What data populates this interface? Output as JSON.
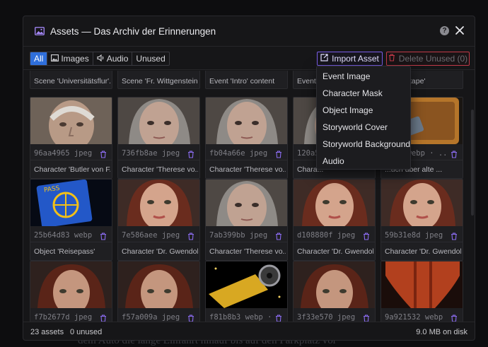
{
  "background_text": "dem Auto die lange Einfahrt hinauf bis auf den Parkplatz vor",
  "modal": {
    "title": "Assets — Das Archiv der Erinnerungen",
    "help_glyph": "?"
  },
  "tabs": [
    {
      "label": "All",
      "active": true,
      "icon": ""
    },
    {
      "label": "Images",
      "active": false,
      "icon": "image-icon"
    },
    {
      "label": "Audio",
      "active": false,
      "icon": "speaker-icon"
    },
    {
      "label": "Unused",
      "active": false,
      "icon": ""
    }
  ],
  "import_label": "Import Asset",
  "delete_label": "Delete Unused (0)",
  "grid": {
    "partial_captions": [
      "Scene 'Universitätsflur'...",
      "Scene 'Fr. Wittgenstein...",
      "Event 'Intro' content",
      "Event '...",
      "...anzertape'"
    ],
    "rows": [
      [
        {
          "meta": "96aa4965 jpeg · ...",
          "caption": "Character 'Butler von F...",
          "thumb": "old-man"
        },
        {
          "meta": "736fb8ae jpeg · ...",
          "caption": "Character 'Therese vo...",
          "thumb": "old-woman"
        },
        {
          "meta": "fb04a66e jpeg · ...",
          "caption": "Character 'Therese vo...",
          "thumb": "old-woman"
        },
        {
          "meta": "120a5...",
          "caption": "Chara...",
          "thumb": "old-woman"
        },
        {
          "meta": "...5 webp · ...",
          "caption": "...uch über alte ...",
          "thumb": "book"
        }
      ],
      [
        {
          "meta": "25b64d83 webp · ...",
          "caption": "Object 'Reisepass'",
          "thumb": "passport"
        },
        {
          "meta": "7e586aee jpeg · ...",
          "caption": "Character 'Dr. Gwendol...",
          "thumb": "red-hair"
        },
        {
          "meta": "7ab399bb jpeg · ...",
          "caption": "Character 'Therese vo...",
          "thumb": "old-woman"
        },
        {
          "meta": "d108880f jpeg · ...",
          "caption": "Character 'Dr. Gwendol...",
          "thumb": "red-hair"
        },
        {
          "meta": "59b31e8d jpeg · ...",
          "caption": "Character 'Dr. Gwendol...",
          "thumb": "red-hair"
        }
      ],
      [
        {
          "meta": "f7b2677d jpeg · ...",
          "caption": "",
          "thumb": "red-hair-dark"
        },
        {
          "meta": "f57a009a jpeg · ...",
          "caption": "",
          "thumb": "red-hair-dark"
        },
        {
          "meta": "f81b8b3 webp · ...",
          "caption": "",
          "thumb": "scroll"
        },
        {
          "meta": "3f33e570 jpeg · ...",
          "caption": "",
          "thumb": "red-hair-dark"
        },
        {
          "meta": "9a921532 webp · ...",
          "caption": "",
          "thumb": "red-cloth"
        }
      ]
    ]
  },
  "dropdown": {
    "items": [
      "Event Image",
      "Character Mask",
      "Object Image",
      "Storyworld Cover",
      "Storyworld Background",
      "Audio"
    ]
  },
  "footer": {
    "asset_count": "23 assets",
    "unused_count": "0 unused",
    "disk_usage": "9.0 MB on disk"
  },
  "colors": {
    "accent_purple": "#7a5de8",
    "danger_red": "#c23a48",
    "tab_active_blue": "#2f6fdb"
  }
}
